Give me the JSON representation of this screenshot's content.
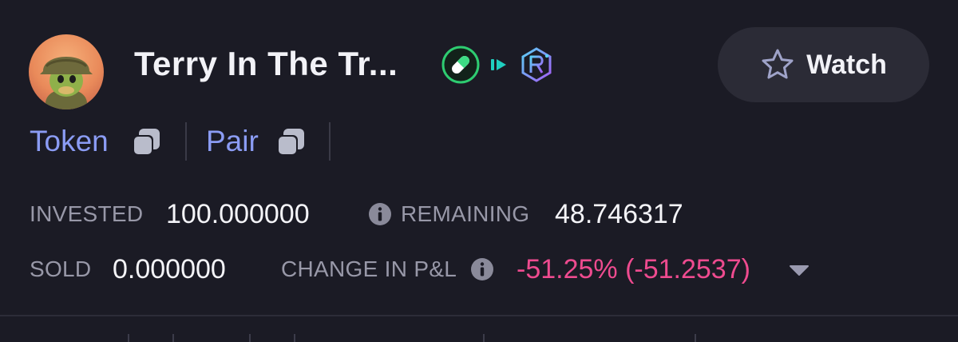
{
  "token": {
    "name": "Terry In The Tr...",
    "watch_label": "Watch"
  },
  "links": {
    "token_label": "Token",
    "pair_label": "Pair"
  },
  "stats": {
    "invested_label": "INVESTED",
    "invested_value": "100.000000",
    "remaining_label": "REMAINING",
    "remaining_value": "48.746317",
    "sold_label": "SOLD",
    "sold_value": "0.000000",
    "change_label": "CHANGE IN P&L",
    "change_value": "-51.25% (-51.2537)"
  },
  "icons": {
    "avatar": "turtle-soldier-avatar",
    "badge_1": "pill-icon",
    "badge_2": "play-icon",
    "badge_3": "raydium-icon",
    "watch": "star-outline-icon",
    "copy": "copy-icon",
    "info": "info-icon",
    "dropdown": "caret-down-icon"
  },
  "colors": {
    "background": "#1b1b25",
    "link": "#8b9cf4",
    "negative": "#ee4b8f",
    "label": "#9898a8",
    "pill_badge": "#2ecc71",
    "raydium_badge": "#6c5ce7",
    "watch_button": "#2b2b36"
  }
}
